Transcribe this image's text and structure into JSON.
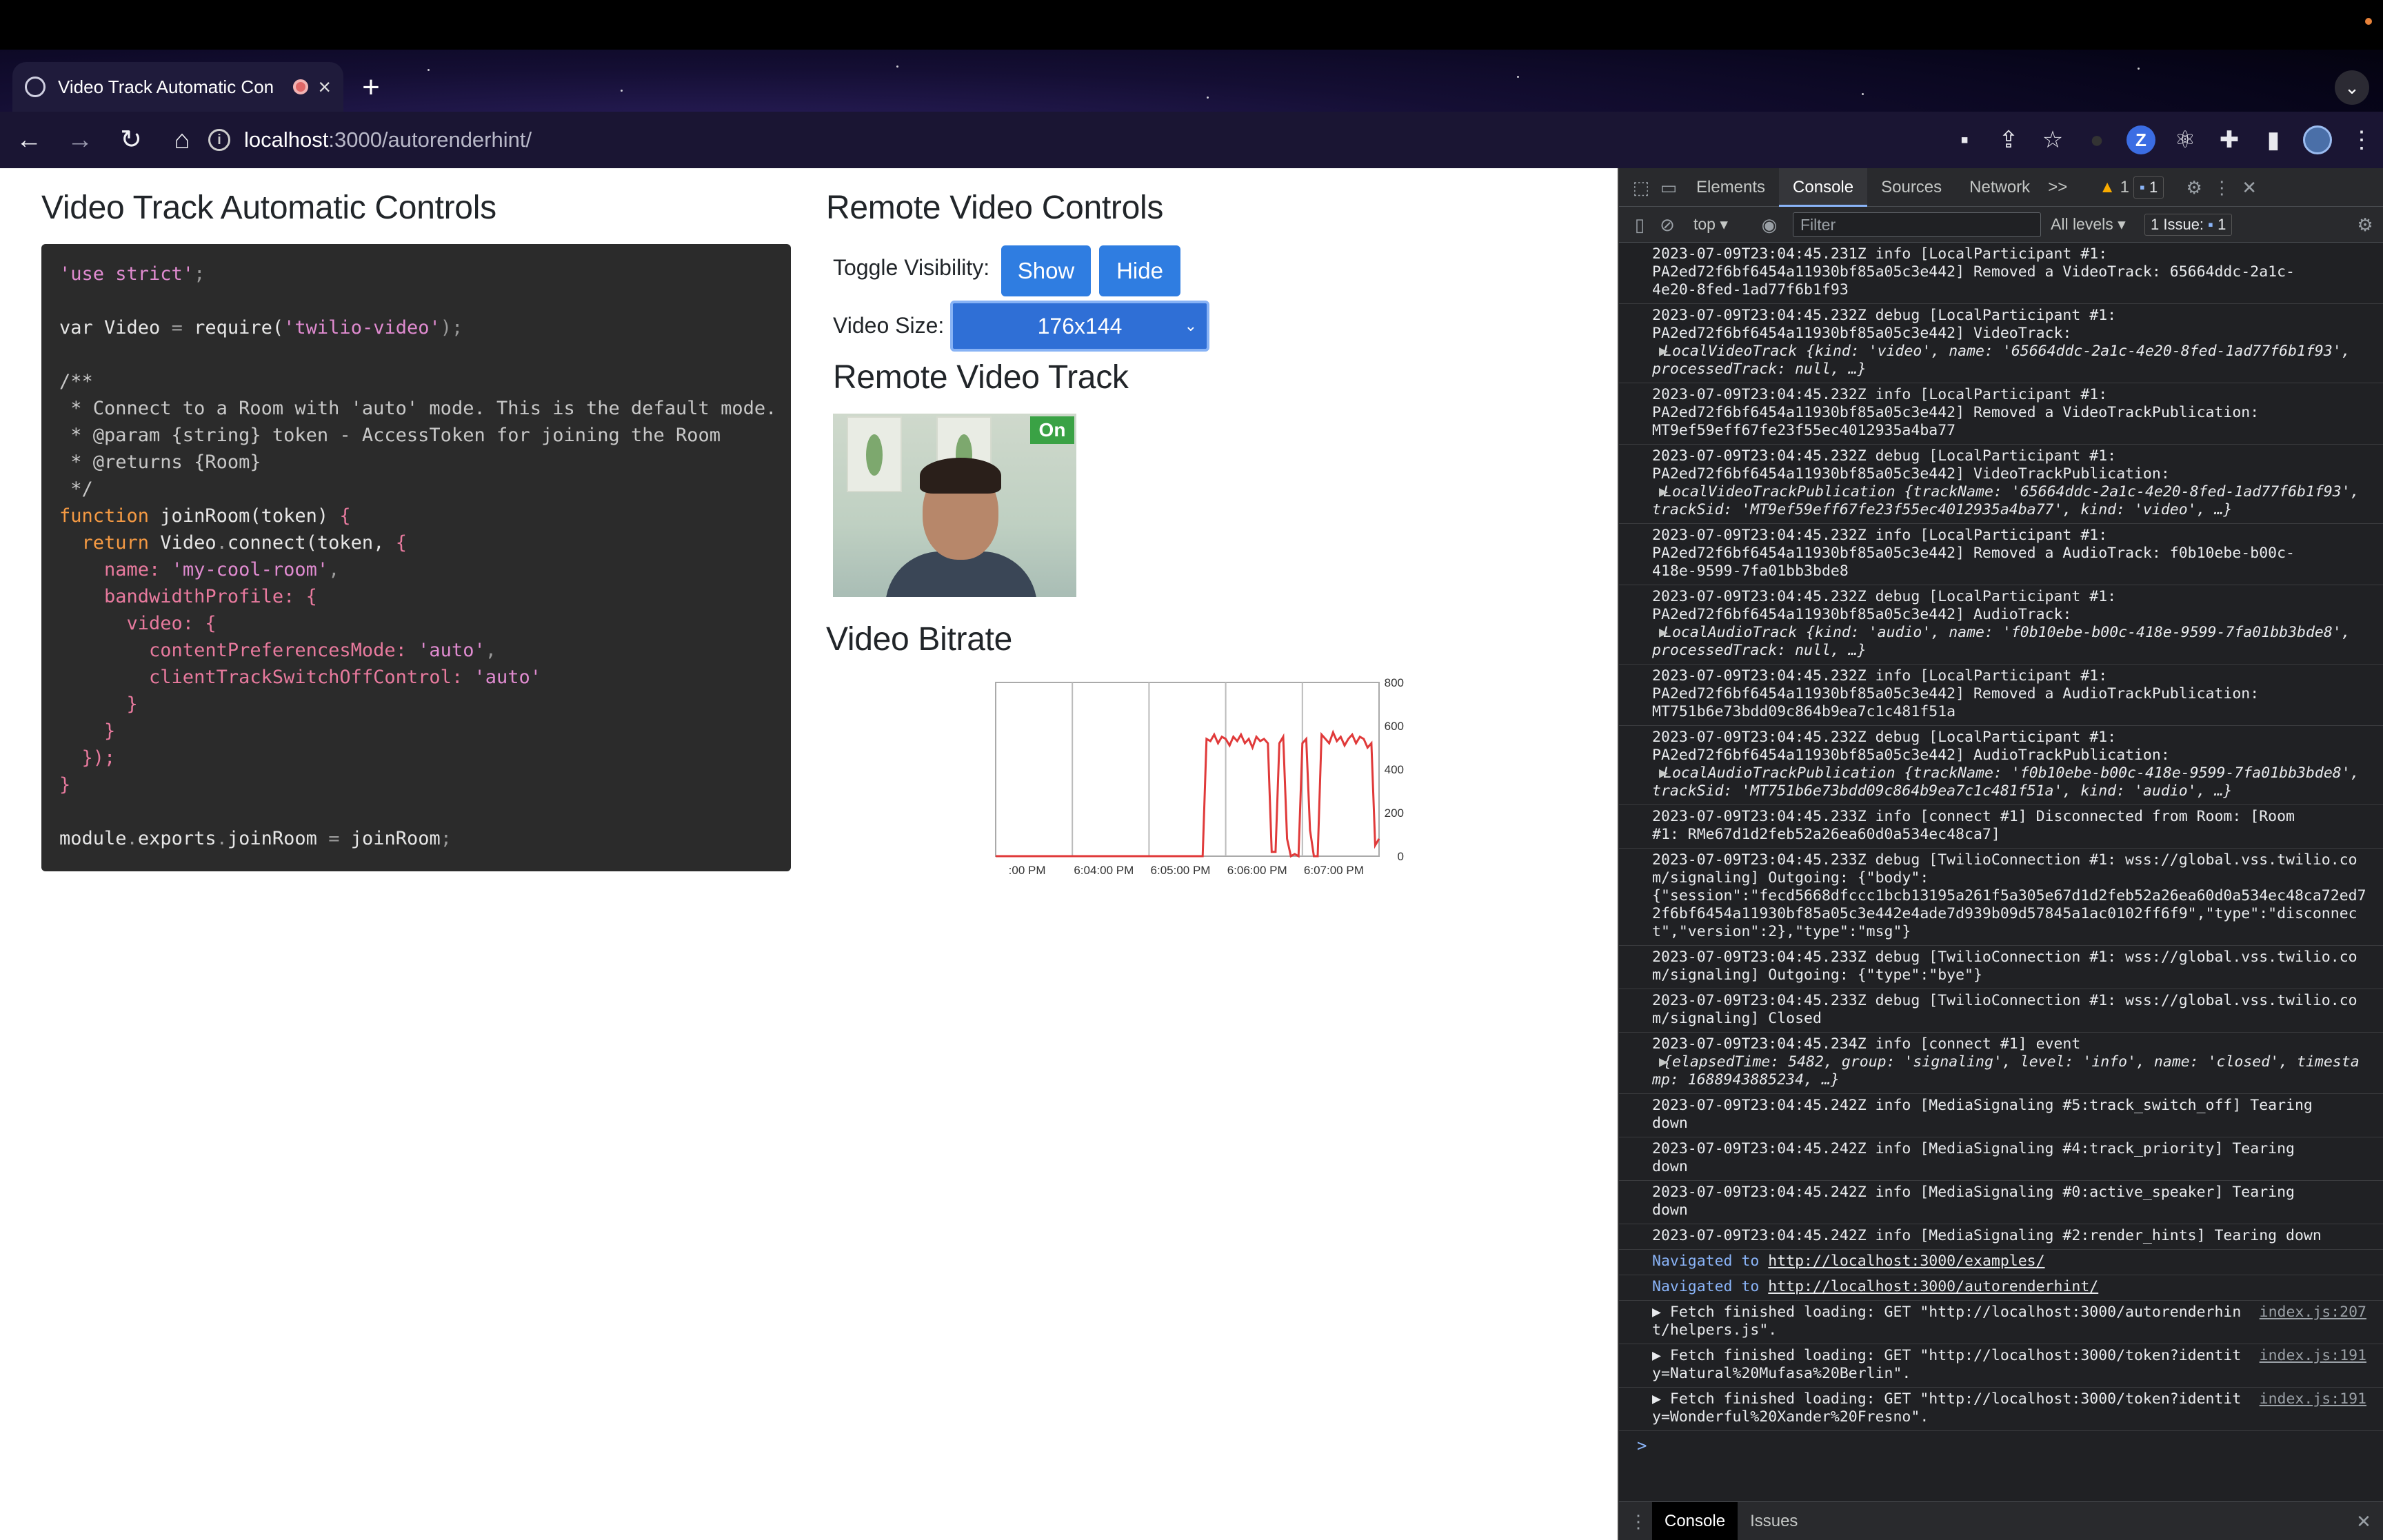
{
  "browser": {
    "tab_title": "Video Track Automatic Con",
    "tab_close": "×",
    "new_tab": "+",
    "url_host": "localhost",
    "url_path": ":3000/autorenderhint/"
  },
  "page": {
    "left_title": "Video Track Automatic Controls",
    "code_lines": [
      [
        {
          "t": "'use strict'",
          "c": "c-str"
        },
        {
          "t": ";",
          "c": "c-punc"
        }
      ],
      [],
      [
        {
          "t": "var",
          "c": "c-fn"
        },
        {
          "t": " Video ",
          "c": "c-fn"
        },
        {
          "t": "=",
          "c": "c-punc"
        },
        {
          "t": " require(",
          "c": "c-fn"
        },
        {
          "t": "'twilio-video'",
          "c": "c-str"
        },
        {
          "t": ");",
          "c": "c-punc"
        }
      ],
      [],
      [
        {
          "t": "/**",
          "c": "c-com"
        }
      ],
      [
        {
          "t": " * Connect to a Room with 'auto' mode. This is the default mode.",
          "c": "c-com"
        }
      ],
      [
        {
          "t": " * @param {string} token - AccessToken for joining the Room",
          "c": "c-com"
        }
      ],
      [
        {
          "t": " * @returns {Room}",
          "c": "c-com"
        }
      ],
      [
        {
          "t": " */",
          "c": "c-com"
        }
      ],
      [
        {
          "t": "function",
          "c": "c-kw"
        },
        {
          "t": " joinRoom(token) ",
          "c": "c-fn"
        },
        {
          "t": "{",
          "c": "c-prop"
        }
      ],
      [
        {
          "t": "  return",
          "c": "c-kw"
        },
        {
          "t": " Video",
          "c": "c-fn"
        },
        {
          "t": ".",
          "c": "c-punc"
        },
        {
          "t": "connect(token, ",
          "c": "c-fn"
        },
        {
          "t": "{",
          "c": "c-prop"
        }
      ],
      [
        {
          "t": "    name: ",
          "c": "c-prop"
        },
        {
          "t": "'my-cool-room'",
          "c": "c-str"
        },
        {
          "t": ",",
          "c": "c-punc"
        }
      ],
      [
        {
          "t": "    bandwidthProfile: {",
          "c": "c-prop"
        }
      ],
      [
        {
          "t": "      video: {",
          "c": "c-prop"
        }
      ],
      [
        {
          "t": "        contentPreferencesMode: ",
          "c": "c-prop"
        },
        {
          "t": "'auto'",
          "c": "c-str"
        },
        {
          "t": ",",
          "c": "c-punc"
        }
      ],
      [
        {
          "t": "        clientTrackSwitchOffControl: ",
          "c": "c-prop"
        },
        {
          "t": "'auto'",
          "c": "c-str"
        }
      ],
      [
        {
          "t": "      }",
          "c": "c-prop"
        }
      ],
      [
        {
          "t": "    }",
          "c": "c-prop"
        }
      ],
      [
        {
          "t": "  });",
          "c": "c-prop"
        }
      ],
      [
        {
          "t": "}",
          "c": "c-prop"
        }
      ],
      [],
      [
        {
          "t": "module",
          "c": "c-fn"
        },
        {
          "t": ".",
          "c": "c-punc"
        },
        {
          "t": "exports",
          "c": "c-fn"
        },
        {
          "t": ".",
          "c": "c-punc"
        },
        {
          "t": "joinRoom ",
          "c": "c-fn"
        },
        {
          "t": "=",
          "c": "c-punc"
        },
        {
          "t": " joinRoom",
          "c": "c-fn"
        },
        {
          "t": ";",
          "c": "c-punc"
        }
      ]
    ],
    "remote_controls_title": "Remote Video Controls",
    "toggle_label": "Toggle Visibility:",
    "show_label": "Show",
    "hide_label": "Hide",
    "size_label": "Video Size:",
    "size_value": "176x144",
    "remote_track_title": "Remote Video Track",
    "on_badge": "On",
    "bitrate_title": "Video Bitrate"
  },
  "chart_data": {
    "type": "line",
    "x_tick_labels": [
      ":00 PM",
      "6:04:00 PM",
      "6:05:00 PM",
      "6:06:00 PM",
      "6:07:00 PM"
    ],
    "y_tick_labels": [
      "800",
      "600",
      "400",
      "200",
      "0"
    ],
    "ylim": [
      0,
      800
    ],
    "grid": true,
    "series": [
      {
        "color": "#e03a3a",
        "x": [
          0,
          10,
          20,
          30,
          40,
          50,
          54,
          55,
          56,
          57,
          58,
          59,
          60,
          61,
          62,
          63,
          64,
          65,
          66,
          67,
          68,
          69,
          70,
          71,
          72,
          73,
          74,
          75,
          76,
          77,
          78,
          79,
          80,
          81,
          82,
          83,
          84,
          85,
          86,
          87,
          88,
          89,
          90,
          91,
          92,
          93,
          94,
          95,
          96,
          97,
          98,
          99,
          100
        ],
        "values": [
          0,
          0,
          0,
          0,
          0,
          0,
          0,
          540,
          530,
          560,
          520,
          550,
          540,
          510,
          550,
          530,
          560,
          520,
          540,
          500,
          550,
          530,
          540,
          520,
          20,
          20,
          520,
          550,
          80,
          0,
          10,
          0,
          520,
          540,
          120,
          0,
          0,
          560,
          540,
          520,
          570,
          530,
          550,
          510,
          540,
          560,
          520,
          550,
          540,
          500,
          520,
          50,
          80
        ]
      }
    ]
  },
  "devtools": {
    "tabs": [
      "Elements",
      "Console",
      "Sources",
      "Network"
    ],
    "more": ">>",
    "warn_count": "1",
    "info_count": "1",
    "context": "top",
    "filter_placeholder": "Filter",
    "levels": "All levels",
    "issues": "1 Issue:",
    "issues_count": "1",
    "messages": [
      {
        "text": "2023-07-09T23:04:45.231Z info [LocalParticipant #1:\nPA2ed72f6bf6454a11930bf85a05c3e442] Removed a VideoTrack: 65664ddc-2a1c-\n4e20-8fed-1ad77f6b1f93"
      },
      {
        "text": "2023-07-09T23:04:45.232Z debug [LocalParticipant #1:\nPA2ed72f6bf6454a11930bf85a05c3e442] VideoTrack:",
        "obj": "LocalVideoTrack {kind: 'video', name: '65664ddc-2a1c-4e20-8fed-1ad77f6b1f93', processedTrack: null, …}"
      },
      {
        "text": "2023-07-09T23:04:45.232Z info [LocalParticipant #1:\nPA2ed72f6bf6454a11930bf85a05c3e442] Removed a VideoTrackPublication:\nMT9ef59eff67fe23f55ec4012935a4ba77"
      },
      {
        "text": "2023-07-09T23:04:45.232Z debug [LocalParticipant #1:\nPA2ed72f6bf6454a11930bf85a05c3e442] VideoTrackPublication:",
        "obj": "LocalVideoTrackPublication {trackName: '65664ddc-2a1c-4e20-8fed-1ad77f6b1f93', trackSid: 'MT9ef59eff67fe23f55ec4012935a4ba77', kind: 'video', …}"
      },
      {
        "text": "2023-07-09T23:04:45.232Z info [LocalParticipant #1:\nPA2ed72f6bf6454a11930bf85a05c3e442] Removed a AudioTrack: f0b10ebe-b00c-\n418e-9599-7fa01bb3bde8"
      },
      {
        "text": "2023-07-09T23:04:45.232Z debug [LocalParticipant #1:\nPA2ed72f6bf6454a11930bf85a05c3e442] AudioTrack:",
        "obj": "LocalAudioTrack {kind: 'audio', name: 'f0b10ebe-b00c-418e-9599-7fa01bb3bde8', processedTrack: null, …}"
      },
      {
        "text": "2023-07-09T23:04:45.232Z info [LocalParticipant #1:\nPA2ed72f6bf6454a11930bf85a05c3e442] Removed a AudioTrackPublication:\nMT751b6e73bdd09c864b9ea7c1c481f51a"
      },
      {
        "text": "2023-07-09T23:04:45.232Z debug [LocalParticipant #1:\nPA2ed72f6bf6454a11930bf85a05c3e442] AudioTrackPublication:",
        "obj": "LocalAudioTrackPublication {trackName: 'f0b10ebe-b00c-418e-9599-7fa01bb3bde8', trackSid: 'MT751b6e73bdd09c864b9ea7c1c481f51a', kind: 'audio', …}"
      },
      {
        "text": "2023-07-09T23:04:45.233Z info [connect #1] Disconnected from Room: [Room\n#1: RMe67d1d2feb52a26ea60d0a534ec48ca7]"
      },
      {
        "text": "2023-07-09T23:04:45.233Z debug [TwilioConnection #1: wss://global.vss.twilio.com/signaling] Outgoing: {\"body\":\n{\"session\":\"fecd5668dfccc1bcb13195a261f5a305e67d1d2feb52a26ea60d0a534ec48ca72ed72f6bf6454a11930bf85a05c3e442e4ade7d939b09d57845a1ac0102ff6f9\",\"type\":\"disconnect\",\"version\":2},\"type\":\"msg\"}"
      },
      {
        "text": "2023-07-09T23:04:45.233Z debug [TwilioConnection #1: wss://global.vss.twilio.com/signaling] Outgoing: {\"type\":\"bye\"}"
      },
      {
        "text": "2023-07-09T23:04:45.233Z debug [TwilioConnection #1: wss://global.vss.twilio.com/signaling] Closed"
      },
      {
        "text": "2023-07-09T23:04:45.234Z info [connect #1] event",
        "obj": "{elapsedTime: 5482, group: 'signaling', level: 'info', name: 'closed', timestamp: 1688943885234, …}"
      },
      {
        "text": "2023-07-09T23:04:45.242Z info [MediaSignaling #5:track_switch_off] Tearing\ndown"
      },
      {
        "text": "2023-07-09T23:04:45.242Z info [MediaSignaling #4:track_priority] Tearing\ndown"
      },
      {
        "text": "2023-07-09T23:04:45.242Z info [MediaSignaling #0:active_speaker] Tearing\ndown"
      },
      {
        "text": "2023-07-09T23:04:45.242Z info [MediaSignaling #2:render_hints] Tearing down"
      }
    ],
    "nav_messages": [
      {
        "prefix": "Navigated to ",
        "url": "http://localhost:3000/examples/"
      },
      {
        "prefix": "Navigated to ",
        "url": "http://localhost:3000/autorenderhint/"
      }
    ],
    "fetch_messages": [
      {
        "text": "Fetch finished loading: GET \"http://localhost:3000/autorenderhint/helpers.js\".",
        "src": "index.js:207"
      },
      {
        "text": "Fetch finished loading: GET \"http://localhost:3000/token?identity=Natural%20Mufasa%20Berlin\".",
        "src": "index.js:191"
      },
      {
        "text": "Fetch finished loading: GET \"http://localhost:3000/token?identity=Wonderful%20Xander%20Fresno\".",
        "src": "index.js:191"
      }
    ],
    "prompt": ">",
    "drawer_tabs": [
      "Console",
      "Issues"
    ]
  }
}
